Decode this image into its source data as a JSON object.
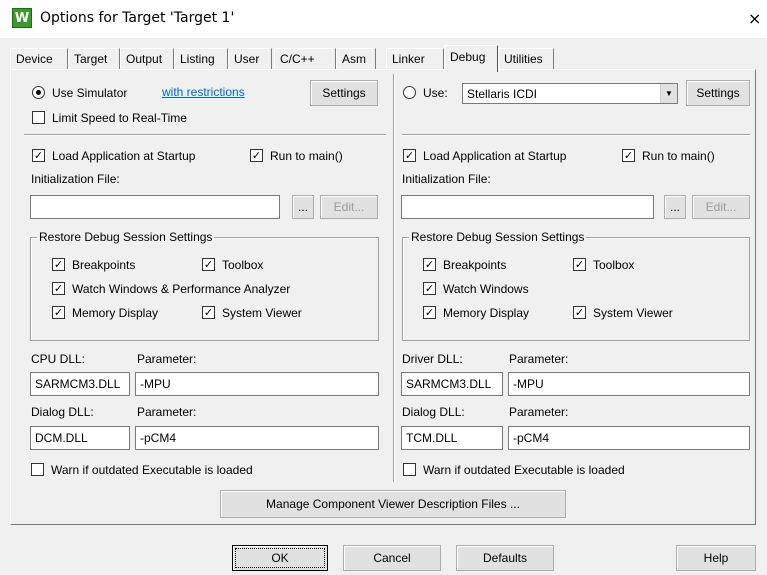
{
  "window": {
    "title": "Options for Target 'Target 1'",
    "icon_glyph": "W",
    "close_glyph": "×"
  },
  "tabs": [
    "Device",
    "Target",
    "Output",
    "Listing",
    "User",
    "C/C++",
    "Asm",
    "Linker",
    "Debug",
    "Utilities"
  ],
  "active_tab": "Debug",
  "left": {
    "use_simulator": "Use Simulator",
    "with_restrictions": "with restrictions",
    "settings": "Settings",
    "limit_speed": "Limit Speed to Real-Time",
    "load_app": "Load Application at Startup",
    "run_to_main": "Run to main()",
    "init_file_label": "Initialization File:",
    "init_file_value": "",
    "browse": "...",
    "edit": "Edit...",
    "restore_group": "Restore Debug Session Settings",
    "breakpoints": "Breakpoints",
    "toolbox": "Toolbox",
    "watch": "Watch Windows & Performance Analyzer",
    "memory": "Memory Display",
    "system_viewer": "System Viewer",
    "cpu_dll_label": "CPU DLL:",
    "param_label": "Parameter:",
    "cpu_dll": "SARMCM3.DLL",
    "cpu_param": "-MPU",
    "dialog_dll_label": "Dialog DLL:",
    "dialog_dll": "DCM.DLL",
    "dialog_param": "-pCM4",
    "warn": "Warn if outdated Executable is loaded"
  },
  "right": {
    "use": "Use:",
    "debugger": "Stellaris ICDI",
    "settings": "Settings",
    "load_app": "Load Application at Startup",
    "run_to_main": "Run to main()",
    "init_file_label": "Initialization File:",
    "init_file_value": "",
    "browse": "...",
    "edit": "Edit...",
    "restore_group": "Restore Debug Session Settings",
    "breakpoints": "Breakpoints",
    "toolbox": "Toolbox",
    "watch": "Watch Windows",
    "memory": "Memory Display",
    "system_viewer": "System Viewer",
    "driver_dll_label": "Driver DLL:",
    "param_label": "Parameter:",
    "driver_dll": "SARMCM3.DLL",
    "driver_param": "-MPU",
    "dialog_dll_label": "Dialog DLL:",
    "dialog_dll": "TCM.DLL",
    "dialog_param": "-pCM4",
    "warn": "Warn if outdated Executable is loaded"
  },
  "manage_button": "Manage Component Viewer Description Files ...",
  "footer": {
    "ok": "OK",
    "cancel": "Cancel",
    "defaults": "Defaults",
    "help": "Help"
  },
  "check_glyph": "✓",
  "colors": {
    "dialog_bg": "#f0f0f0",
    "link": "#0066cc",
    "icon_green": "#3a9a2a"
  }
}
